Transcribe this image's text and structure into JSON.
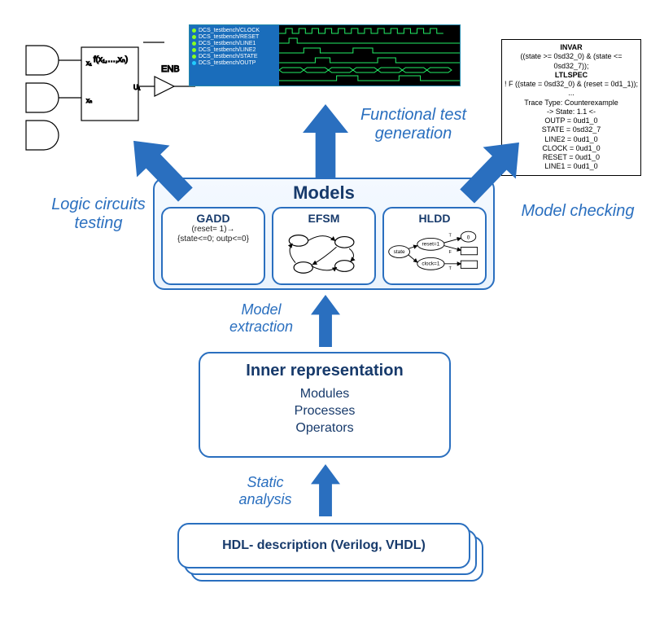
{
  "labels": {
    "logic_testing": "Logic circuits testing",
    "func_test_gen": "Functional test generation",
    "model_checking": "Model checking",
    "model_extraction": "Model extraction",
    "static_analysis": "Static analysis"
  },
  "hdl": {
    "title": "HDL- description (Verilog, VHDL)"
  },
  "inner_rep": {
    "title": "Inner representation",
    "lines": [
      "Modules",
      "Processes",
      "Operators"
    ]
  },
  "models": {
    "title": "Models",
    "gadd": {
      "title": "GADD",
      "line1": "(reset= 1)→",
      "line2": "{state<=0; outp<=0}"
    },
    "efsm": {
      "title": "EFSM"
    },
    "hldd": {
      "title": "HLDD",
      "n_state": "state",
      "n_reset": "reset=1",
      "n_clock": "clock=1",
      "n_zero": "0"
    }
  },
  "circuit": {
    "fbox": "f(x₁,…,xₙ)",
    "enb": "ENB",
    "u": "U₁"
  },
  "mc_output": {
    "l1": "INVAR",
    "l2": "((state >= 0sd32_0) & (state <= 0sd32_7));",
    "l3": "LTLSPEC",
    "l4": "! F ((state = 0sd32_0) & (reset = 0d1_1));",
    "l5": "...",
    "l6": "Trace Type: Counterexample",
    "l7": "-> State: 1.1 <-",
    "l8": "OUTP = 0ud1_0",
    "l9": "STATE = 0sd32_7",
    "l10": "LINE2 = 0ud1_0",
    "l11": "CLOCK = 0ud1_0",
    "l12": "RESET = 0ud1_0",
    "l13": "LINE1 = 0ud1_0"
  },
  "waveform": {
    "signals": [
      "DCS_testbench/CLOCK",
      "DCS_testbench/RESET",
      "DCS_testbench/LINE1",
      "DCS_testbench/LINE2",
      "DCS_testbench/STATE",
      "DCS_testbench/OUTP"
    ]
  }
}
